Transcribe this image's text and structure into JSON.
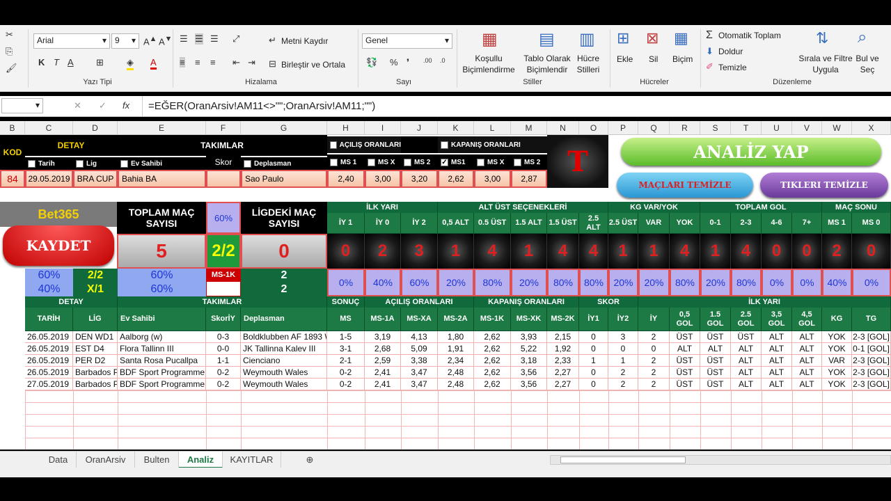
{
  "ribbon": {
    "font_name": "Arial",
    "font_size": "9",
    "font_group": "Yazı Tipi",
    "align_group": "Hizalama",
    "wrap_text": "Metni Kaydır",
    "merge_center": "Birleştir ve Ortala",
    "number_format": "Genel",
    "number_group": "Sayı",
    "cond_format": "Koşullu\nBiçimlendirme",
    "format_table": "Tablo Olarak\nBiçimlendir",
    "cell_styles": "Hücre\nStilleri",
    "styles_group": "Stiller",
    "insert": "Ekle",
    "delete": "Sil",
    "format": "Biçim",
    "cells_group": "Hücreler",
    "autosum": "Otomatik Toplam",
    "fill": "Doldur",
    "clear": "Temizle",
    "sort_filter": "Sırala ve Filtre\nUygula",
    "find_select": "Bul ve\nSeç",
    "editing_group": "Düzenleme"
  },
  "formula_bar": {
    "formula": "=EĞER(OranArsiv!AM11<>\"\";OranArsiv!AM11;\"\")",
    "fx": "fx"
  },
  "columns": [
    "B",
    "C",
    "D",
    "E",
    "F",
    "G",
    "H",
    "I",
    "J",
    "K",
    "L",
    "M",
    "N",
    "O",
    "P",
    "Q",
    "R",
    "S",
    "T",
    "U",
    "V",
    "W",
    "X"
  ],
  "top": {
    "kod": "KOD",
    "detay": "DETAY",
    "takimlar": "TAKIMLAR",
    "skor": "Skor",
    "acilis": "AÇILIŞ ORANLARI",
    "kapanis": "KAPANIŞ ORANLARI",
    "tarih": "Tarih",
    "lig": "Lig",
    "ev_sahibi": "Ev Sahibi",
    "deplasman": "Deplasman",
    "ms1": "MS 1",
    "msx": "MS X",
    "ms2": "MS 2",
    "kms1": "MS1",
    "kmsx": "MS X",
    "kms2": "MS 2",
    "row": {
      "kod": "84",
      "tarih": "29.05.2019",
      "lig": "BRA CUP",
      "ev": "Bahia BA",
      "dep": "Sao Paulo",
      "o1": "2,40",
      "o2": "3,00",
      "o3": "3,20",
      "k1": "2,62",
      "k2": "3,00",
      "k3": "2,87"
    },
    "logo": "T",
    "analiz_btn": "ANALİZ YAP",
    "maclari_btn": "MAÇLARI TEMİZLE",
    "tikleri_btn": "TIKLERI TEMİZLE"
  },
  "stats": {
    "bet365": "Bet365",
    "kaydet": "KAYDET",
    "toplam": "TOPLAM MAÇ\nSAYISI",
    "toplam_val": "5",
    "pct_top": "60%",
    "ratio": "2/2",
    "ligdeki": "LİGDEKİ MAÇ\nSAYISI",
    "lig_val": "0",
    "ms1k": "MS-1K",
    "left_a": "60%",
    "left_b": "40%",
    "left_c": "2/2",
    "left_d": "X/1",
    "mid_a": "60%",
    "mid_b": "60%",
    "right_a": "2",
    "right_b": "2",
    "groups": [
      "İLK YARI",
      "ALT ÜST SEÇENEKLERİ",
      "KG VAR/YOK",
      "TOPLAM GOL",
      "MAÇ SONU"
    ],
    "headers": [
      "İY 1",
      "İY 0",
      "İY 2",
      "0,5 ALT",
      "0.5 ÜST",
      "1.5 ALT",
      "1.5 ÜST",
      "2.5\nALT",
      "2.5 ÜST",
      "VAR",
      "YOK",
      "0-1",
      "2-3",
      "4-6",
      "7+",
      "MS 1",
      "MS 0"
    ],
    "counts": [
      "0",
      "2",
      "3",
      "1",
      "4",
      "1",
      "4",
      "4",
      "1",
      "1",
      "4",
      "1",
      "4",
      "0",
      "0",
      "2",
      "0"
    ],
    "pcts": [
      "0%",
      "40%",
      "60%",
      "20%",
      "80%",
      "20%",
      "80%",
      "80%",
      "20%",
      "20%",
      "80%",
      "20%",
      "80%",
      "0%",
      "0%",
      "40%",
      "0%"
    ]
  },
  "table": {
    "g_detay": "DETAY",
    "g_takimlar": "TAKIMLAR",
    "g_sonuc": "SONUÇ",
    "g_acilis": "AÇILIŞ ORANLARI",
    "g_kapanis": "KAPANIŞ ORANLARI",
    "g_skor": "SKOR",
    "g_ilkyari": "İLK YARI",
    "headers": [
      "TARİH",
      "LİG",
      "Ev Sahibi",
      "SkorİY",
      "Deplasman",
      "MS",
      "MS-1A",
      "MS-XA",
      "MS-2A",
      "MS-1K",
      "MS-XK",
      "MS-2K",
      "İY1",
      "İY2",
      "İY",
      "0,5\nGOL",
      "1.5\nGOL",
      "2.5\nGOL",
      "3,5\nGOL",
      "4,5\nGOL",
      "KG",
      "TG"
    ],
    "rows": [
      [
        "26.05.2019",
        "DEN WD1",
        "Aalborg (w)",
        "0-3",
        "Boldklubben AF 1893 W",
        "1-5",
        "3,19",
        "4,13",
        "1,80",
        "2,62",
        "3,93",
        "2,15",
        "0",
        "3",
        "2",
        "ÜST",
        "ÜST",
        "ÜST",
        "ALT",
        "ALT",
        "YOK",
        "2-3 [GOL]"
      ],
      [
        "26.05.2019",
        "EST D4",
        "Flora Tallinn III",
        "0-0",
        "JK Tallinna Kalev III",
        "3-1",
        "2,68",
        "5,09",
        "1,91",
        "2,62",
        "5,22",
        "1,92",
        "0",
        "0",
        "0",
        "ALT",
        "ALT",
        "ALT",
        "ALT",
        "ALT",
        "YOK",
        "0-1 [GOL]"
      ],
      [
        "26.05.2019",
        "PER D2",
        "Santa Rosa Pucallpa",
        "1-1",
        "Cienciano",
        "2-1",
        "2,59",
        "3,38",
        "2,34",
        "2,62",
        "3,18",
        "2,33",
        "1",
        "1",
        "2",
        "ÜST",
        "ÜST",
        "ALT",
        "ALT",
        "ALT",
        "VAR",
        "2-3 [GOL]"
      ],
      [
        "26.05.2019",
        "Barbados P",
        "BDF Sport Programme",
        "0-2",
        "Weymouth Wales",
        "0-2",
        "2,41",
        "3,47",
        "2,48",
        "2,62",
        "3,56",
        "2,27",
        "0",
        "2",
        "2",
        "ÜST",
        "ÜST",
        "ALT",
        "ALT",
        "ALT",
        "YOK",
        "2-3 [GOL]"
      ],
      [
        "27.05.2019",
        "Barbados P",
        "BDF Sport Programme",
        "0-2",
        "Weymouth Wales",
        "0-2",
        "2,41",
        "3,47",
        "2,48",
        "2,62",
        "3,56",
        "2,27",
        "0",
        "2",
        "2",
        "ÜST",
        "ÜST",
        "ALT",
        "ALT",
        "ALT",
        "YOK",
        "2-3 [GOL]"
      ]
    ]
  },
  "tabs": [
    "Data",
    "OranArsiv",
    "Bulten",
    "Analiz",
    "KAYITLAR"
  ],
  "active_tab": "Analiz",
  "colors": {
    "green": "#106a3c",
    "yellow": "#f5d000",
    "red": "#e02020",
    "purple": "#b8b0ee"
  }
}
